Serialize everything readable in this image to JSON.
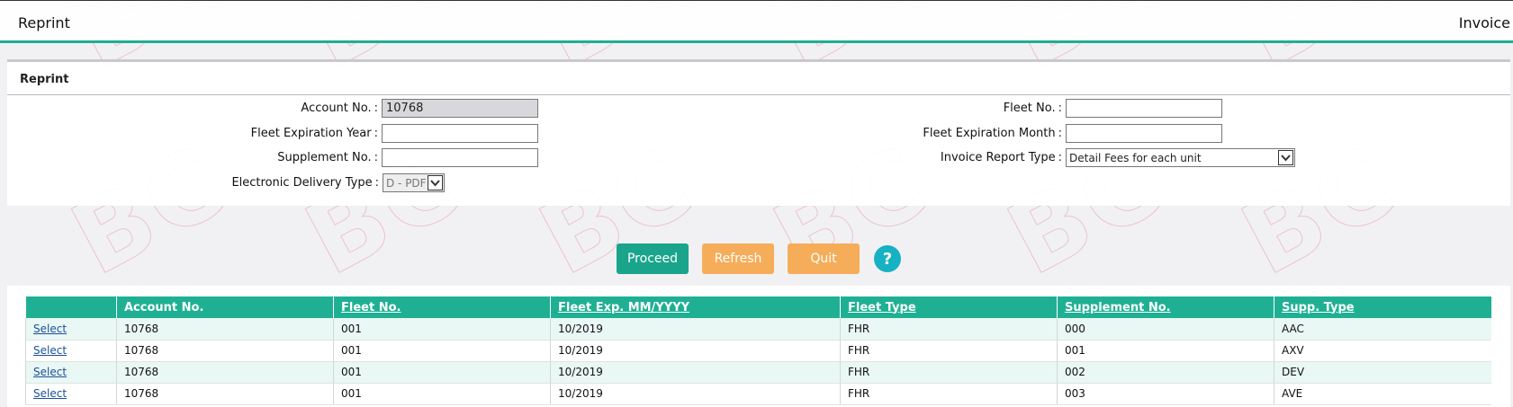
{
  "header": {
    "left_title": "Reprint",
    "right_title": "Invoice"
  },
  "watermark": {
    "text": "BC"
  },
  "form": {
    "section_title": "Reprint",
    "account_no": {
      "label": "Account No.",
      "value": "10768"
    },
    "fleet_no": {
      "label": "Fleet No.",
      "value": ""
    },
    "fleet_exp_year": {
      "label": "Fleet Expiration Year",
      "value": ""
    },
    "fleet_exp_month": {
      "label": "Fleet Expiration Month",
      "value": ""
    },
    "supplement_no": {
      "label": "Supplement No.",
      "value": ""
    },
    "invoice_report_type": {
      "label": "Invoice Report Type",
      "value": "Detail Fees for each unit"
    },
    "electronic_delivery_type": {
      "label": "Electronic Delivery Type",
      "value": "D - PDF"
    },
    "colon": ":"
  },
  "buttons": {
    "proceed": "Proceed",
    "refresh": "Refresh",
    "quit": "Quit",
    "help": "?"
  },
  "colors": {
    "accent": "#1fb094",
    "orange": "#f5ad5a",
    "help": "#17b1c4"
  },
  "table": {
    "headers": [
      "",
      "Account No.",
      "Fleet No.",
      "Fleet Exp. MM/YYYY",
      "Fleet Type",
      "Supplement No.",
      "Supp. Type"
    ],
    "rows": [
      {
        "select": "Select",
        "account": "10768",
        "fleet": "001",
        "exp": "10/2019",
        "type": "FHR",
        "supp": "000",
        "supp_type": "AAC"
      },
      {
        "select": "Select",
        "account": "10768",
        "fleet": "001",
        "exp": "10/2019",
        "type": "FHR",
        "supp": "001",
        "supp_type": "AXV"
      },
      {
        "select": "Select",
        "account": "10768",
        "fleet": "001",
        "exp": "10/2019",
        "type": "FHR",
        "supp": "002",
        "supp_type": "DEV"
      },
      {
        "select": "Select",
        "account": "10768",
        "fleet": "001",
        "exp": "10/2019",
        "type": "FHR",
        "supp": "003",
        "supp_type": "AVE"
      }
    ]
  }
}
